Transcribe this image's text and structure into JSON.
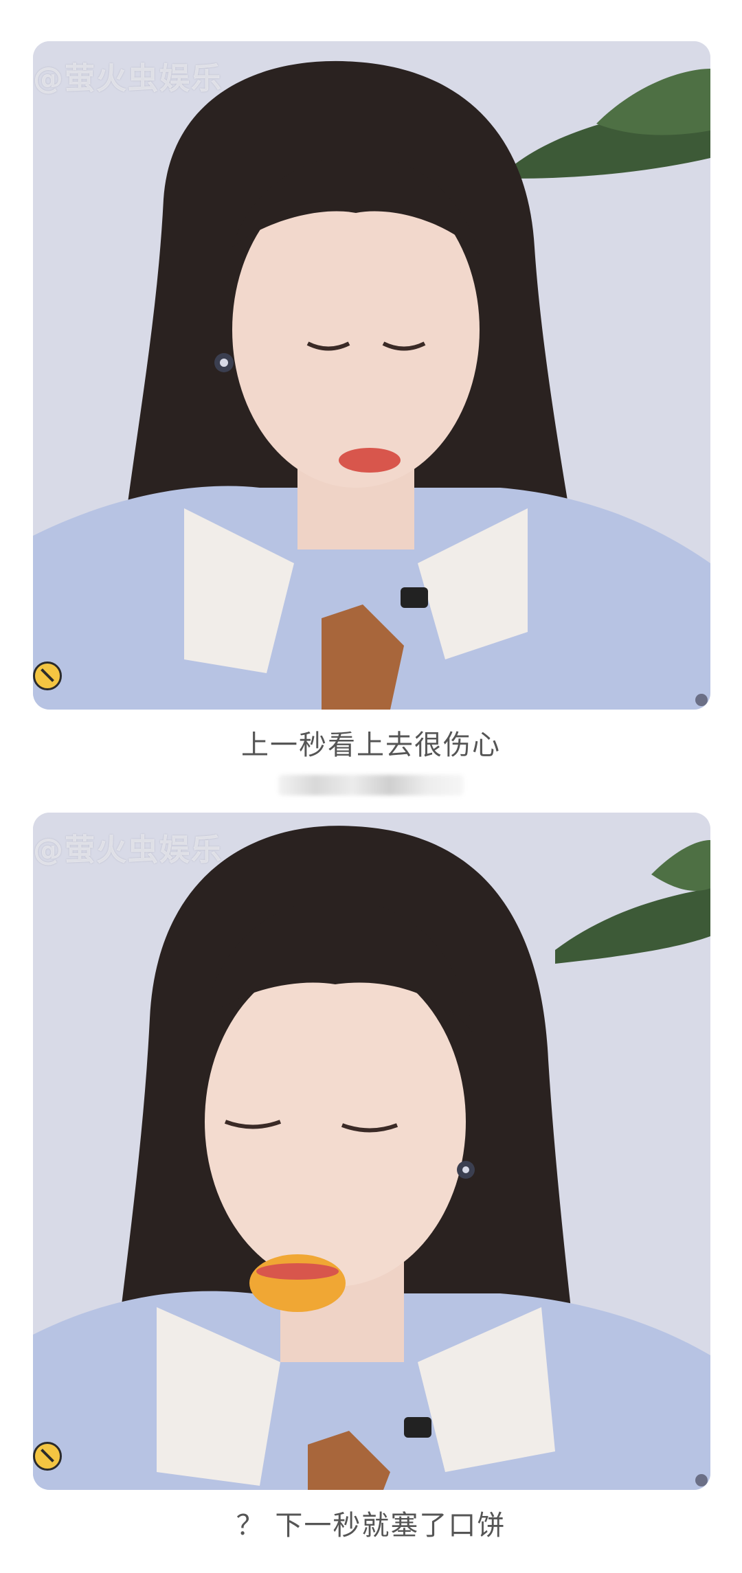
{
  "post": {
    "caption_1": "上一秒看上去很伤心",
    "caption_2": "？ 下一秒就塞了口饼"
  },
  "images": [
    {
      "watermark": "@萤火虫娱乐",
      "badge_icon": "no-entry-emoji-icon",
      "description_icon": "video-frame-woman-looking-down"
    },
    {
      "watermark": "@萤火虫娱乐",
      "badge_icon": "no-entry-emoji-icon",
      "description_icon": "video-frame-woman-eating-cake"
    }
  ],
  "colors": {
    "background": "#ffffff",
    "caption_text": "#555555",
    "photo_wall": "#d9dbe8",
    "shirt": "#b7c3e3",
    "hair": "#2a2220"
  }
}
